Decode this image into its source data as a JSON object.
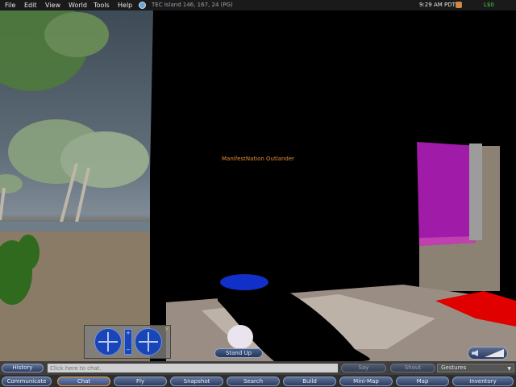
{
  "menu": {
    "file": "File",
    "edit": "Edit",
    "view": "View",
    "world": "World",
    "tools": "Tools",
    "help": "Help"
  },
  "status": {
    "location": "TEC Island 146, 167, 24 (PG)",
    "time": "9:29 AM PDT",
    "balance": "L$0"
  },
  "scene": {
    "avatar_name": "ManifestNation Outlander"
  },
  "controls": {
    "zoom_plus": "+",
    "zoom_minus": "−",
    "close": "×",
    "stand_up": "Stand Up"
  },
  "chat": {
    "history": "History",
    "placeholder": "Click here to chat.",
    "say": "Say",
    "shout": "Shout",
    "gestures": "Gestures"
  },
  "toolbar": {
    "communicate": "Communicate",
    "chat": "Chat",
    "fly": "Fly",
    "snapshot": "Snapshot",
    "search": "Search",
    "build": "Build",
    "minimap": "Mini-Map",
    "map": "Map",
    "inventory": "Inventory"
  },
  "colors": {
    "name_tag": "#e28a3a",
    "balance": "#3fd04a",
    "active_border": "#f0a030"
  }
}
